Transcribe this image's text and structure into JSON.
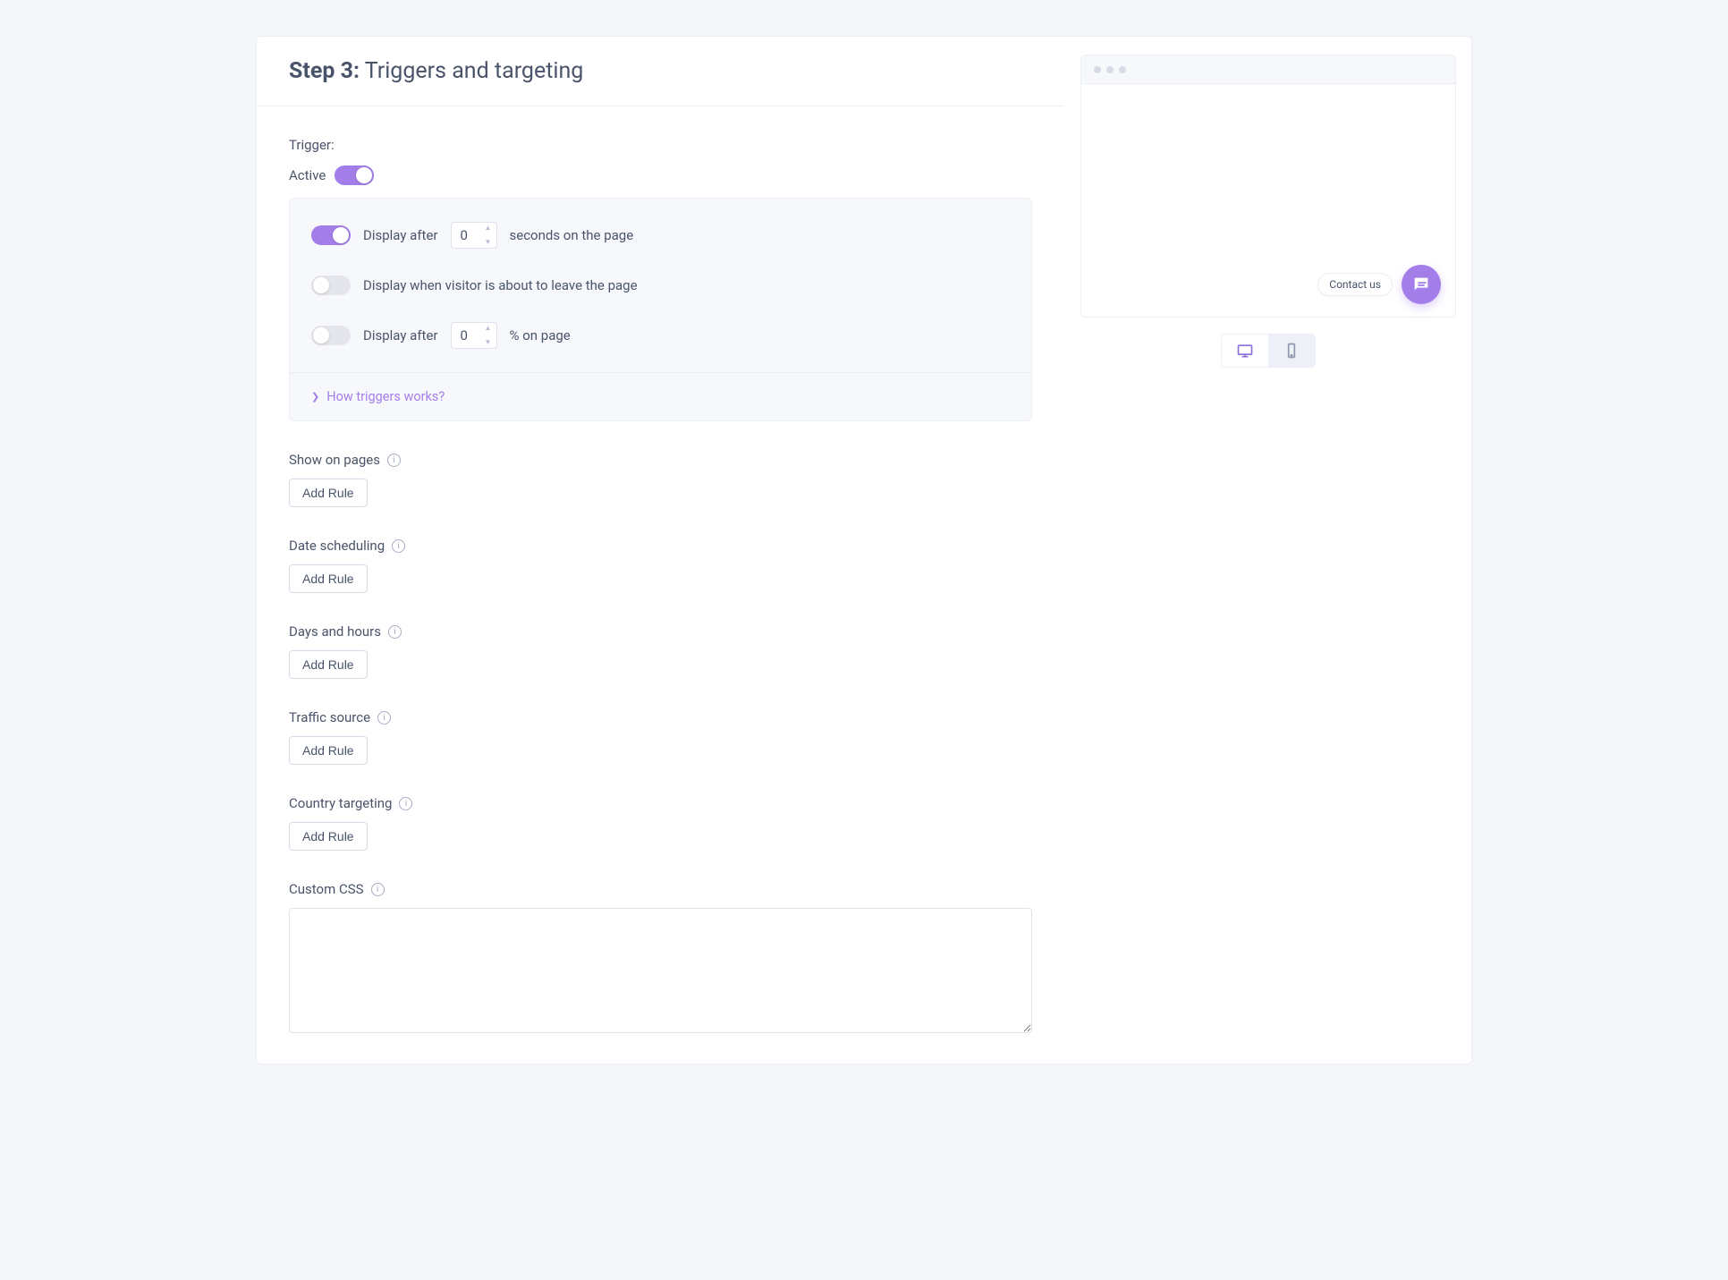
{
  "step": {
    "prefix": "Step 3:",
    "title": "Triggers and targeting"
  },
  "trigger_label": "Trigger:",
  "active_label": "Active",
  "triggers": {
    "after_seconds": {
      "prefix": "Display after",
      "value": "0",
      "suffix": "seconds on the page",
      "on": true
    },
    "exit_intent": {
      "label": "Display when visitor is about to leave the page",
      "on": false
    },
    "after_percent": {
      "prefix": "Display after",
      "value": "0",
      "suffix": "% on page",
      "on": false
    }
  },
  "triggers_help": "How triggers works?",
  "sections": {
    "show_on_pages": {
      "label": "Show on pages",
      "button": "Add Rule"
    },
    "date_scheduling": {
      "label": "Date scheduling",
      "button": "Add Rule"
    },
    "days_hours": {
      "label": "Days and hours",
      "button": "Add Rule"
    },
    "traffic_source": {
      "label": "Traffic source",
      "button": "Add Rule"
    },
    "country_targeting": {
      "label": "Country targeting",
      "button": "Add Rule"
    },
    "custom_css": {
      "label": "Custom CSS"
    }
  },
  "preview": {
    "bubble_label": "Contact us"
  }
}
